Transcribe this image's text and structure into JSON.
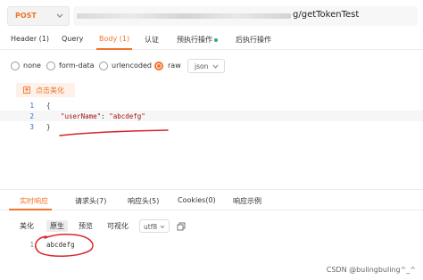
{
  "request": {
    "method": "POST",
    "url_visible": "g/getTokenTest"
  },
  "tabs": [
    {
      "label": "Header (1)"
    },
    {
      "label": "Query"
    },
    {
      "label": "Body (1)"
    },
    {
      "label": "认证"
    },
    {
      "label": "预执行操作"
    },
    {
      "label": "后执行操作"
    }
  ],
  "body_types": [
    {
      "label": "none"
    },
    {
      "label": "form-data"
    },
    {
      "label": "urlencoded"
    },
    {
      "label": "raw"
    }
  ],
  "raw_format": "json",
  "beautify_label": "点击美化",
  "editor": {
    "lines": [
      "1",
      "2",
      "3"
    ],
    "open_brace": "{",
    "key": "\"userName\"",
    "colon": ": ",
    "value": "\"abcdefg\"",
    "close_brace": "}"
  },
  "response_tabs": [
    {
      "label": "实时响应"
    },
    {
      "label": "请求头(7)"
    },
    {
      "label": "响应头(5)"
    },
    {
      "label": "Cookies(0)"
    },
    {
      "label": "响应示例"
    }
  ],
  "view_buttons": [
    {
      "label": "美化"
    },
    {
      "label": "原生"
    },
    {
      "label": "预览"
    },
    {
      "label": "可视化"
    }
  ],
  "encoding": "utf8",
  "response": {
    "line": "1",
    "text": "abcdefg"
  },
  "watermark": "CSDN @bulingbuling^_^",
  "colors": {
    "accent": "#f2742b",
    "status_dot": "#2fae6a",
    "scribble": "#d9232a"
  }
}
